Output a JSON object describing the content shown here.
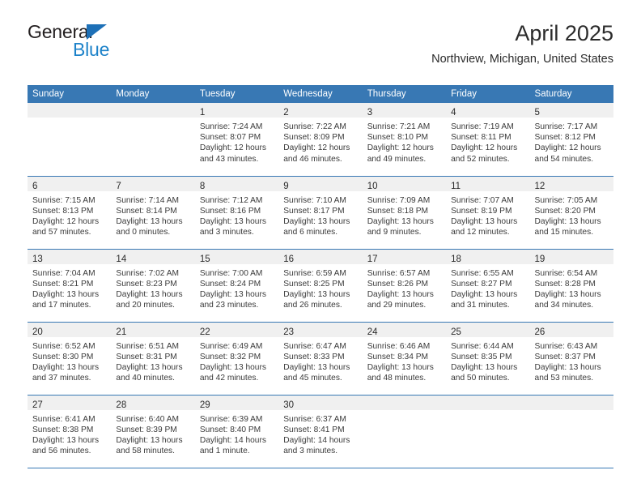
{
  "brand": {
    "word_one": "General",
    "word_two": "Blue",
    "accent_dark": "#231f20",
    "accent_blue": "#1d82c9",
    "triangle_color": "#1d70b7"
  },
  "header": {
    "title": "April 2025",
    "subtitle": "Northview, Michigan, United States"
  },
  "theme": {
    "header_band": "#3878b4",
    "daynum_band": "#f0f0f0",
    "text": "#2b2b2b"
  },
  "weekdays": [
    "Sunday",
    "Monday",
    "Tuesday",
    "Wednesday",
    "Thursday",
    "Friday",
    "Saturday"
  ],
  "labels": {
    "sunrise": "Sunrise:",
    "sunset": "Sunset:",
    "daylight": "Daylight:"
  },
  "weeks": [
    [
      {
        "day": "",
        "sunrise": "",
        "sunset": "",
        "daylight": ""
      },
      {
        "day": "",
        "sunrise": "",
        "sunset": "",
        "daylight": ""
      },
      {
        "day": "1",
        "sunrise": "Sunrise: 7:24 AM",
        "sunset": "Sunset: 8:07 PM",
        "daylight": "Daylight: 12 hours and 43 minutes."
      },
      {
        "day": "2",
        "sunrise": "Sunrise: 7:22 AM",
        "sunset": "Sunset: 8:09 PM",
        "daylight": "Daylight: 12 hours and 46 minutes."
      },
      {
        "day": "3",
        "sunrise": "Sunrise: 7:21 AM",
        "sunset": "Sunset: 8:10 PM",
        "daylight": "Daylight: 12 hours and 49 minutes."
      },
      {
        "day": "4",
        "sunrise": "Sunrise: 7:19 AM",
        "sunset": "Sunset: 8:11 PM",
        "daylight": "Daylight: 12 hours and 52 minutes."
      },
      {
        "day": "5",
        "sunrise": "Sunrise: 7:17 AM",
        "sunset": "Sunset: 8:12 PM",
        "daylight": "Daylight: 12 hours and 54 minutes."
      }
    ],
    [
      {
        "day": "6",
        "sunrise": "Sunrise: 7:15 AM",
        "sunset": "Sunset: 8:13 PM",
        "daylight": "Daylight: 12 hours and 57 minutes."
      },
      {
        "day": "7",
        "sunrise": "Sunrise: 7:14 AM",
        "sunset": "Sunset: 8:14 PM",
        "daylight": "Daylight: 13 hours and 0 minutes."
      },
      {
        "day": "8",
        "sunrise": "Sunrise: 7:12 AM",
        "sunset": "Sunset: 8:16 PM",
        "daylight": "Daylight: 13 hours and 3 minutes."
      },
      {
        "day": "9",
        "sunrise": "Sunrise: 7:10 AM",
        "sunset": "Sunset: 8:17 PM",
        "daylight": "Daylight: 13 hours and 6 minutes."
      },
      {
        "day": "10",
        "sunrise": "Sunrise: 7:09 AM",
        "sunset": "Sunset: 8:18 PM",
        "daylight": "Daylight: 13 hours and 9 minutes."
      },
      {
        "day": "11",
        "sunrise": "Sunrise: 7:07 AM",
        "sunset": "Sunset: 8:19 PM",
        "daylight": "Daylight: 13 hours and 12 minutes."
      },
      {
        "day": "12",
        "sunrise": "Sunrise: 7:05 AM",
        "sunset": "Sunset: 8:20 PM",
        "daylight": "Daylight: 13 hours and 15 minutes."
      }
    ],
    [
      {
        "day": "13",
        "sunrise": "Sunrise: 7:04 AM",
        "sunset": "Sunset: 8:21 PM",
        "daylight": "Daylight: 13 hours and 17 minutes."
      },
      {
        "day": "14",
        "sunrise": "Sunrise: 7:02 AM",
        "sunset": "Sunset: 8:23 PM",
        "daylight": "Daylight: 13 hours and 20 minutes."
      },
      {
        "day": "15",
        "sunrise": "Sunrise: 7:00 AM",
        "sunset": "Sunset: 8:24 PM",
        "daylight": "Daylight: 13 hours and 23 minutes."
      },
      {
        "day": "16",
        "sunrise": "Sunrise: 6:59 AM",
        "sunset": "Sunset: 8:25 PM",
        "daylight": "Daylight: 13 hours and 26 minutes."
      },
      {
        "day": "17",
        "sunrise": "Sunrise: 6:57 AM",
        "sunset": "Sunset: 8:26 PM",
        "daylight": "Daylight: 13 hours and 29 minutes."
      },
      {
        "day": "18",
        "sunrise": "Sunrise: 6:55 AM",
        "sunset": "Sunset: 8:27 PM",
        "daylight": "Daylight: 13 hours and 31 minutes."
      },
      {
        "day": "19",
        "sunrise": "Sunrise: 6:54 AM",
        "sunset": "Sunset: 8:28 PM",
        "daylight": "Daylight: 13 hours and 34 minutes."
      }
    ],
    [
      {
        "day": "20",
        "sunrise": "Sunrise: 6:52 AM",
        "sunset": "Sunset: 8:30 PM",
        "daylight": "Daylight: 13 hours and 37 minutes."
      },
      {
        "day": "21",
        "sunrise": "Sunrise: 6:51 AM",
        "sunset": "Sunset: 8:31 PM",
        "daylight": "Daylight: 13 hours and 40 minutes."
      },
      {
        "day": "22",
        "sunrise": "Sunrise: 6:49 AM",
        "sunset": "Sunset: 8:32 PM",
        "daylight": "Daylight: 13 hours and 42 minutes."
      },
      {
        "day": "23",
        "sunrise": "Sunrise: 6:47 AM",
        "sunset": "Sunset: 8:33 PM",
        "daylight": "Daylight: 13 hours and 45 minutes."
      },
      {
        "day": "24",
        "sunrise": "Sunrise: 6:46 AM",
        "sunset": "Sunset: 8:34 PM",
        "daylight": "Daylight: 13 hours and 48 minutes."
      },
      {
        "day": "25",
        "sunrise": "Sunrise: 6:44 AM",
        "sunset": "Sunset: 8:35 PM",
        "daylight": "Daylight: 13 hours and 50 minutes."
      },
      {
        "day": "26",
        "sunrise": "Sunrise: 6:43 AM",
        "sunset": "Sunset: 8:37 PM",
        "daylight": "Daylight: 13 hours and 53 minutes."
      }
    ],
    [
      {
        "day": "27",
        "sunrise": "Sunrise: 6:41 AM",
        "sunset": "Sunset: 8:38 PM",
        "daylight": "Daylight: 13 hours and 56 minutes."
      },
      {
        "day": "28",
        "sunrise": "Sunrise: 6:40 AM",
        "sunset": "Sunset: 8:39 PM",
        "daylight": "Daylight: 13 hours and 58 minutes."
      },
      {
        "day": "29",
        "sunrise": "Sunrise: 6:39 AM",
        "sunset": "Sunset: 8:40 PM",
        "daylight": "Daylight: 14 hours and 1 minute."
      },
      {
        "day": "30",
        "sunrise": "Sunrise: 6:37 AM",
        "sunset": "Sunset: 8:41 PM",
        "daylight": "Daylight: 14 hours and 3 minutes."
      },
      {
        "day": "",
        "sunrise": "",
        "sunset": "",
        "daylight": ""
      },
      {
        "day": "",
        "sunrise": "",
        "sunset": "",
        "daylight": ""
      },
      {
        "day": "",
        "sunrise": "",
        "sunset": "",
        "daylight": ""
      }
    ]
  ]
}
